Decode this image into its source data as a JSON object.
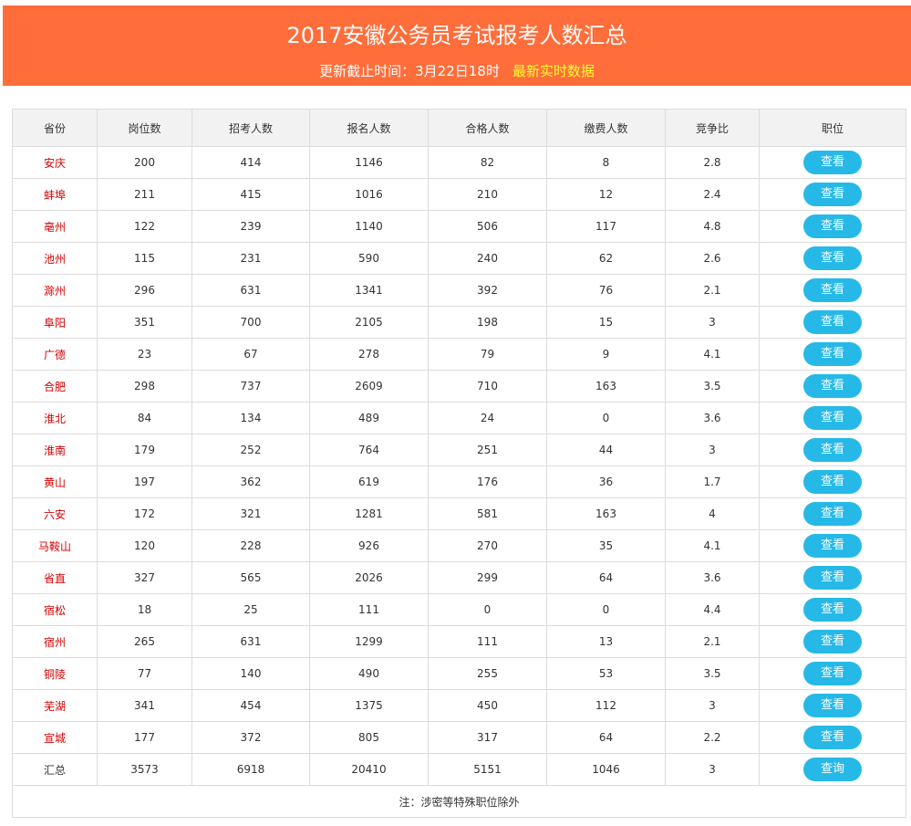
{
  "header": {
    "title": "2017安徽公务员考试报考人数汇总",
    "update_text": "更新截止时间：3月22日18时",
    "live_text": "最新实时数据"
  },
  "table": {
    "columns": [
      "省份",
      "岗位数",
      "招考人数",
      "报名人数",
      "合格人数",
      "缴费人数",
      "竞争比",
      "职位"
    ],
    "rows": [
      {
        "province": "安庆",
        "posts": "200",
        "recruit": "414",
        "applied": "1146",
        "qualified": "82",
        "paid": "8",
        "ratio": "2.8",
        "btn": "查看"
      },
      {
        "province": "蚌埠",
        "posts": "211",
        "recruit": "415",
        "applied": "1016",
        "qualified": "210",
        "paid": "12",
        "ratio": "2.4",
        "btn": "查看"
      },
      {
        "province": "亳州",
        "posts": "122",
        "recruit": "239",
        "applied": "1140",
        "qualified": "506",
        "paid": "117",
        "ratio": "4.8",
        "btn": "查看"
      },
      {
        "province": "池州",
        "posts": "115",
        "recruit": "231",
        "applied": "590",
        "qualified": "240",
        "paid": "62",
        "ratio": "2.6",
        "btn": "查看"
      },
      {
        "province": "滁州",
        "posts": "296",
        "recruit": "631",
        "applied": "1341",
        "qualified": "392",
        "paid": "76",
        "ratio": "2.1",
        "btn": "查看"
      },
      {
        "province": "阜阳",
        "posts": "351",
        "recruit": "700",
        "applied": "2105",
        "qualified": "198",
        "paid": "15",
        "ratio": "3",
        "btn": "查看"
      },
      {
        "province": "广德",
        "posts": "23",
        "recruit": "67",
        "applied": "278",
        "qualified": "79",
        "paid": "9",
        "ratio": "4.1",
        "btn": "查看"
      },
      {
        "province": "合肥",
        "posts": "298",
        "recruit": "737",
        "applied": "2609",
        "qualified": "710",
        "paid": "163",
        "ratio": "3.5",
        "btn": "查看"
      },
      {
        "province": "淮北",
        "posts": "84",
        "recruit": "134",
        "applied": "489",
        "qualified": "24",
        "paid": "0",
        "ratio": "3.6",
        "btn": "查看"
      },
      {
        "province": "淮南",
        "posts": "179",
        "recruit": "252",
        "applied": "764",
        "qualified": "251",
        "paid": "44",
        "ratio": "3",
        "btn": "查看"
      },
      {
        "province": "黄山",
        "posts": "197",
        "recruit": "362",
        "applied": "619",
        "qualified": "176",
        "paid": "36",
        "ratio": "1.7",
        "btn": "查看"
      },
      {
        "province": "六安",
        "posts": "172",
        "recruit": "321",
        "applied": "1281",
        "qualified": "581",
        "paid": "163",
        "ratio": "4",
        "btn": "查看"
      },
      {
        "province": "马鞍山",
        "posts": "120",
        "recruit": "228",
        "applied": "926",
        "qualified": "270",
        "paid": "35",
        "ratio": "4.1",
        "btn": "查看"
      },
      {
        "province": "省直",
        "posts": "327",
        "recruit": "565",
        "applied": "2026",
        "qualified": "299",
        "paid": "64",
        "ratio": "3.6",
        "btn": "查看"
      },
      {
        "province": "宿松",
        "posts": "18",
        "recruit": "25",
        "applied": "111",
        "qualified": "0",
        "paid": "0",
        "ratio": "4.4",
        "btn": "查看"
      },
      {
        "province": "宿州",
        "posts": "265",
        "recruit": "631",
        "applied": "1299",
        "qualified": "111",
        "paid": "13",
        "ratio": "2.1",
        "btn": "查看"
      },
      {
        "province": "铜陵",
        "posts": "77",
        "recruit": "140",
        "applied": "490",
        "qualified": "255",
        "paid": "53",
        "ratio": "3.5",
        "btn": "查看"
      },
      {
        "province": "芜湖",
        "posts": "341",
        "recruit": "454",
        "applied": "1375",
        "qualified": "450",
        "paid": "112",
        "ratio": "3",
        "btn": "查看"
      },
      {
        "province": "宣城",
        "posts": "177",
        "recruit": "372",
        "applied": "805",
        "qualified": "317",
        "paid": "64",
        "ratio": "2.2",
        "btn": "查看"
      },
      {
        "province": "汇总",
        "posts": "3573",
        "recruit": "6918",
        "applied": "20410",
        "qualified": "5151",
        "paid": "1046",
        "ratio": "3",
        "btn": "查询"
      }
    ],
    "note": "注：涉密等特殊职位除外"
  },
  "colors": {
    "header_bg": "#ff6d3a",
    "button": "#26b9e8",
    "province_text": "#d60000",
    "live_text": "#ffff33"
  }
}
